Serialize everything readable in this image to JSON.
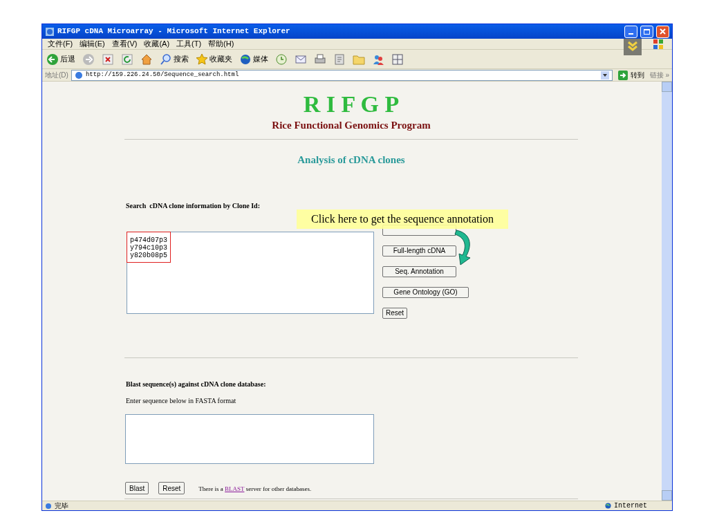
{
  "window": {
    "title": "RIFGP cDNA Microarray - Microsoft Internet Explorer"
  },
  "menu": [
    "文件(F)",
    "编辑(E)",
    "查看(V)",
    "收藏(A)",
    "工具(T)",
    "帮助(H)"
  ],
  "toolbar": [
    {
      "kind": "back",
      "label": "后退"
    },
    {
      "kind": "forward"
    },
    {
      "kind": "stop"
    },
    {
      "kind": "refresh"
    },
    {
      "kind": "home"
    },
    {
      "kind": "search",
      "label": "搜索"
    },
    {
      "kind": "favorites",
      "label": "收藏夹"
    },
    {
      "kind": "media",
      "label": "媒体"
    },
    {
      "kind": "history"
    },
    {
      "kind": "mail"
    },
    {
      "kind": "print"
    },
    {
      "kind": "edit"
    },
    {
      "kind": "folder"
    },
    {
      "kind": "messenger"
    },
    {
      "kind": "tool"
    }
  ],
  "address": {
    "label": "地址(D)",
    "url": "http://159.226.24.50/Sequence_search.html",
    "go": "转到",
    "links": "链接 »"
  },
  "page": {
    "logo": "R I F G P",
    "subtitle": "Rice Functional Genomics Program",
    "heading": "Analysis of cDNA clones",
    "clone_search": {
      "label": "Search  cDNA clone information by Clone Id:",
      "value": "p474d07p3\ny794c10p3\ny820b08p5",
      "covered_button": true,
      "buttons": [
        {
          "label": "Full-length cDNA"
        },
        {
          "label": "Seq. Annotation"
        },
        {
          "label": "Gene Ontology (GO)"
        },
        {
          "label": "Reset"
        }
      ]
    },
    "callout": "Click here to get the sequence annotation",
    "blast": {
      "label": "Blast sequence(s) against cDNA clone database:",
      "hint": "Enter sequence below in FASTA format",
      "buttons": [
        "Blast",
        "Reset"
      ],
      "note_before": "There is a ",
      "link": "BLAST",
      "note_after": " server for other databases."
    }
  },
  "status_bar": {
    "text": "完毕",
    "zone": "Internet"
  }
}
